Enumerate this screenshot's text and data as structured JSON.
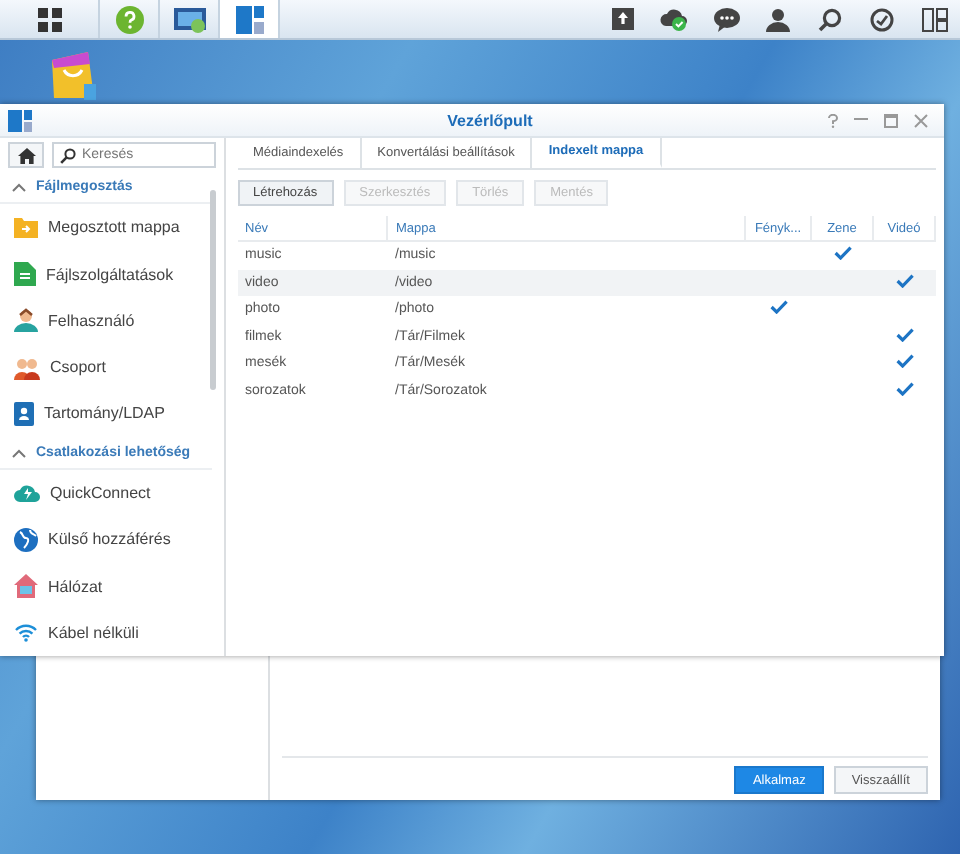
{
  "taskbar": {
    "left_icons": [
      {
        "kind": "grid",
        "selected": false
      },
      {
        "kind": "help",
        "selected": false
      },
      {
        "kind": "video",
        "selected": false
      },
      {
        "kind": "panel",
        "selected": true
      }
    ],
    "right_icons": [
      {
        "kind": "upload"
      },
      {
        "kind": "cloud"
      },
      {
        "kind": "chat"
      },
      {
        "kind": "user"
      },
      {
        "kind": "search"
      },
      {
        "kind": "gauge"
      },
      {
        "kind": "widgets"
      }
    ]
  },
  "window": {
    "title": "Vezérlőpult",
    "sidebar": {
      "search": {
        "placeholder": "Keresés"
      },
      "sections": [
        {
          "title": "Fájlmegosztás",
          "expanded": true,
          "items": [
            {
              "label": "Megosztott mappa",
              "kind": "folder"
            },
            {
              "label": "Fájlszolgáltatások",
              "kind": "files"
            },
            {
              "label": "Felhasználó",
              "kind": "user"
            },
            {
              "label": "Csoport",
              "kind": "group"
            },
            {
              "label": "Tartomány/LDAP",
              "kind": "domain"
            }
          ]
        },
        {
          "title": "Csatlakozási lehetőség",
          "expanded": true,
          "items": [
            {
              "label": "QuickConnect",
              "kind": "cloud"
            },
            {
              "label": "Külső hozzáférés",
              "kind": "globe"
            },
            {
              "label": "Hálózat",
              "kind": "house"
            },
            {
              "label": "Kábel nélküli",
              "kind": "wifi"
            }
          ]
        }
      ]
    },
    "tabs": [
      {
        "label": "Médiaindexelés",
        "selected": false
      },
      {
        "label": "Konvertálási beállítások",
        "selected": false
      },
      {
        "label": "Indexelt mappa",
        "selected": true
      }
    ],
    "toolbar": [
      {
        "label": "Létrehozás",
        "disabled": false
      },
      {
        "label": "Szerkesztés",
        "disabled": true
      },
      {
        "label": "Törlés",
        "disabled": true
      },
      {
        "label": "Mentés",
        "disabled": true
      }
    ],
    "table": {
      "columns": [
        "Név",
        "Mappa",
        "Fényk...",
        "Zene",
        "Videó"
      ],
      "rows": [
        {
          "name": "music",
          "folder": "/music",
          "flags": [
            false,
            true,
            false
          ],
          "selected": false
        },
        {
          "name": "video",
          "folder": "/video",
          "flags": [
            false,
            false,
            true
          ],
          "selected": true
        },
        {
          "name": "photo",
          "folder": "/photo",
          "flags": [
            true,
            false,
            false
          ],
          "selected": false
        },
        {
          "name": "filmek",
          "folder": "/Tár/Filmek",
          "flags": [
            false,
            false,
            true
          ],
          "selected": false
        },
        {
          "name": "mesék",
          "folder": "/Tár/Mesék",
          "flags": [
            false,
            false,
            true
          ],
          "selected": false
        },
        {
          "name": "sorozatok",
          "folder": "/Tár/Sorozatok",
          "flags": [
            false,
            false,
            true
          ],
          "selected": false
        }
      ]
    }
  },
  "back_window": {
    "buttons": [
      {
        "label": "Alkalmaz",
        "kind": "primary"
      },
      {
        "label": "Visszaállít",
        "kind": "secondary"
      }
    ]
  }
}
